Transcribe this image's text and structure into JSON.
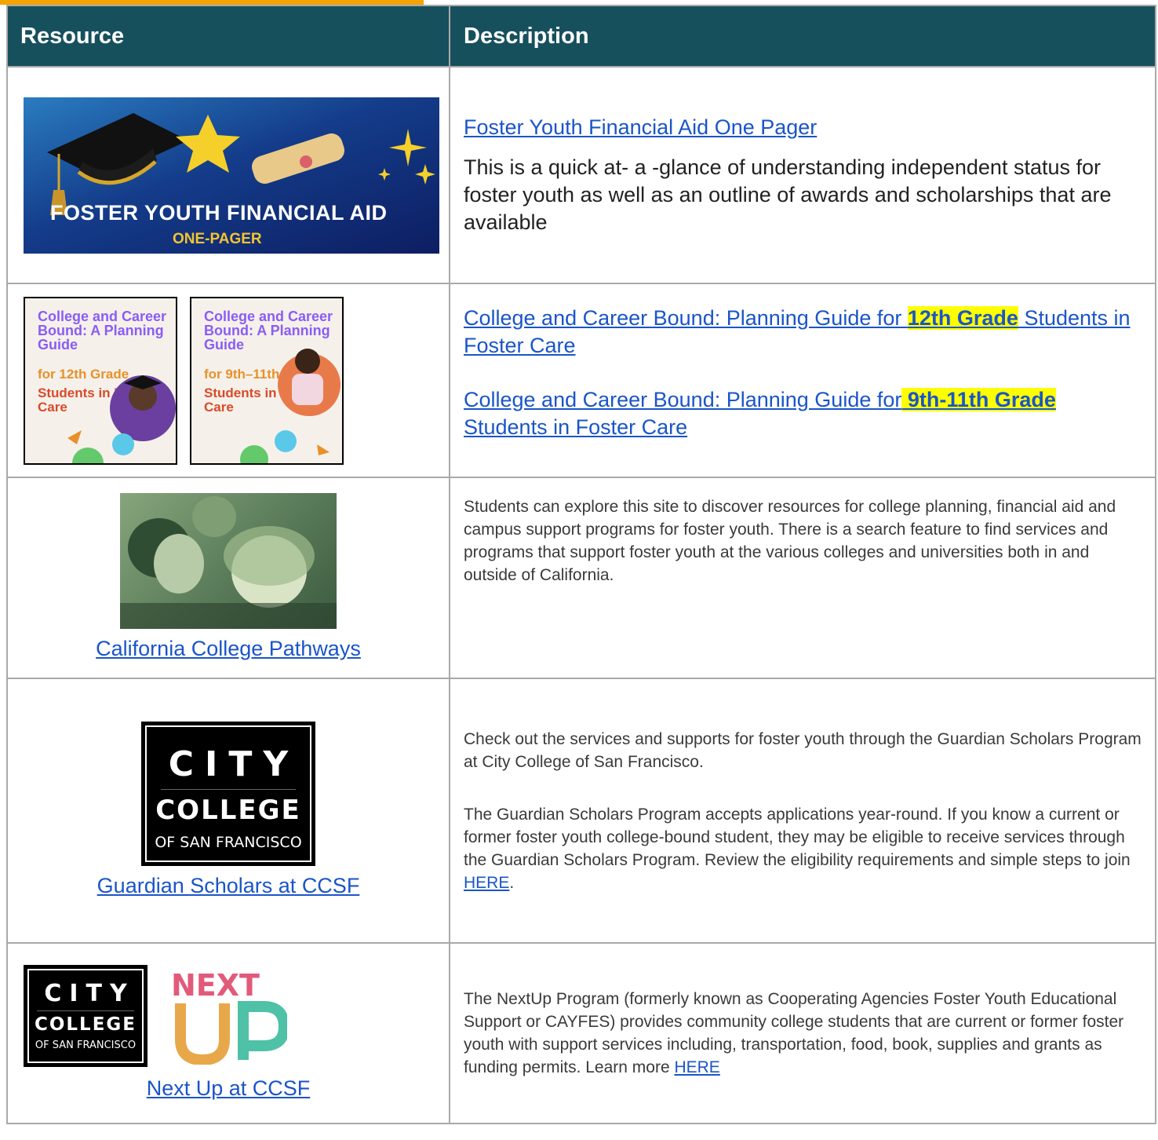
{
  "header": {
    "resource": "Resource",
    "description": "Description"
  },
  "rows": [
    {
      "banner_title": "FOSTER YOUTH FINANCIAL AID",
      "banner_sub": "ONE-PAGER",
      "link": "Foster Youth Financial Aid One Pager",
      "text": "This is a quick at- a -glance of understanding independent status for foster youth as well as an outline of awards and scholarships that are available"
    },
    {
      "cover1": {
        "title": "College and Career Bound: A Planning Guide",
        "grade": "for 12th Grade",
        "students": "Students in Foster Care"
      },
      "cover2": {
        "title": "College and Career Bound: A Planning Guide",
        "grade": "for 9th–11th Grade",
        "students": "Students in Foster Care"
      },
      "link1_pre": "College and Career Bound: Planning Guide for ",
      "link1_hl": "12th Grade",
      "link1_post": " Students in Foster Care",
      "link2_pre": "College and Career Bound: Planning Guide for",
      "link2_hl": " 9th-11th Grade",
      "link2_post": "Students in Foster Care"
    },
    {
      "link": "California College Pathways",
      "text": "Students can explore this site to discover resources for college planning, financial aid and campus support programs for foster youth.   There is a search feature to find services and programs that support foster youth at the various colleges and universities both  in and outside of California."
    },
    {
      "logo_l1": "CITY",
      "logo_l2": "COLLEGE",
      "logo_l3": "OF SAN FRANCISCO",
      "link": "Guardian Scholars at CCSF",
      "p1": "Check out the services and supports for foster youth through the Guardian Scholars Program at City College of San Francisco.",
      "p2_pre": "The Guardian Scholars Program accepts applications year-round.  If you know  a current or former foster youth college-bound student, they may be eligible to receive services through the Guardian Scholars Program. Review the eligibility requirements and simple steps to join ",
      "p2_link": "HERE",
      "p2_post": "."
    },
    {
      "logo_l1": "CITY",
      "logo_l2": "COLLEGE",
      "logo_l3": "OF SAN FRANCISCO",
      "nextup_top": "NEXT",
      "nextup_bottom": "UP",
      "link": "Next Up at CCSF",
      "text_pre": "The NextUp Program (formerly known as Cooperating Agencies Foster Youth Educational Support or CAYFES) provides community college students that are current or former foster youth with support services including, transportation, food, book, supplies and grants as funding permits. Learn more ",
      "text_link": "HERE"
    }
  ]
}
